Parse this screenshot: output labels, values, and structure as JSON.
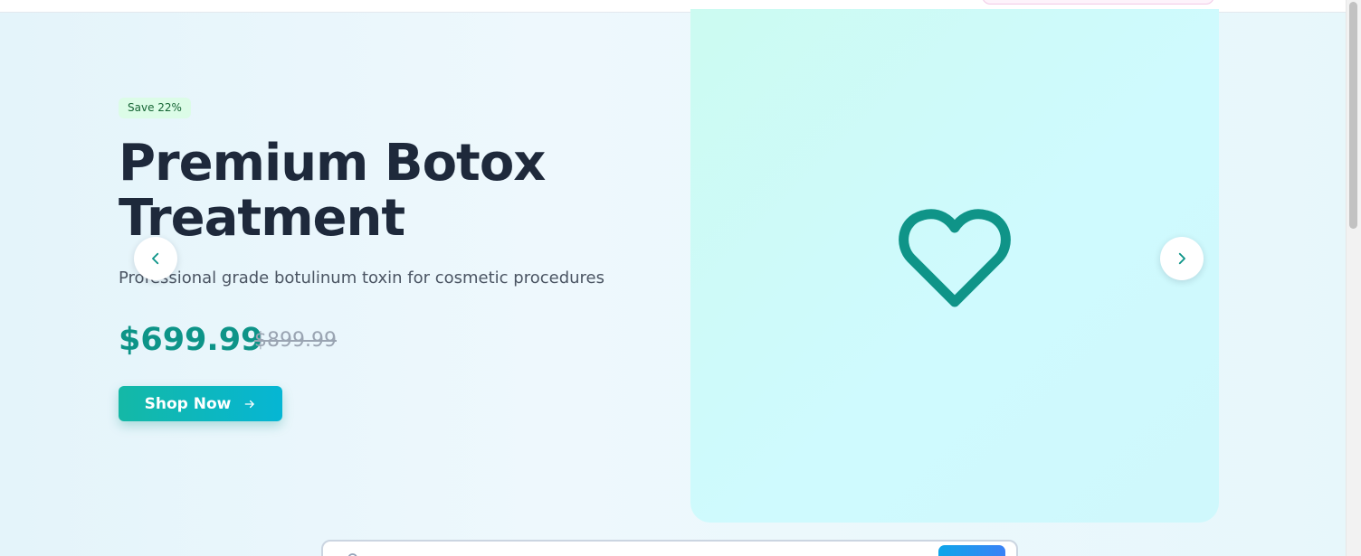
{
  "hero": {
    "badge": "Save 22%",
    "title": "Premium Botox Treatment",
    "subtitle": "Professional grade botulinum toxin for cosmetic procedures",
    "price": "$699.99",
    "old_price": "$899.99",
    "cta_label": "Shop Now",
    "image_icon": "heart-icon"
  },
  "carousel": {
    "prev_icon": "chevron-left-icon",
    "next_icon": "chevron-right-icon"
  },
  "search": {
    "icon": "search-icon"
  },
  "colors": {
    "accent": "#0d9488",
    "title": "#1e293b",
    "badge_bg": "#dcfce7",
    "badge_text": "#166534",
    "cta_gradient_start": "#14b8a6",
    "cta_gradient_end": "#06b6d4",
    "panel_bg": "#ccfbf1"
  }
}
